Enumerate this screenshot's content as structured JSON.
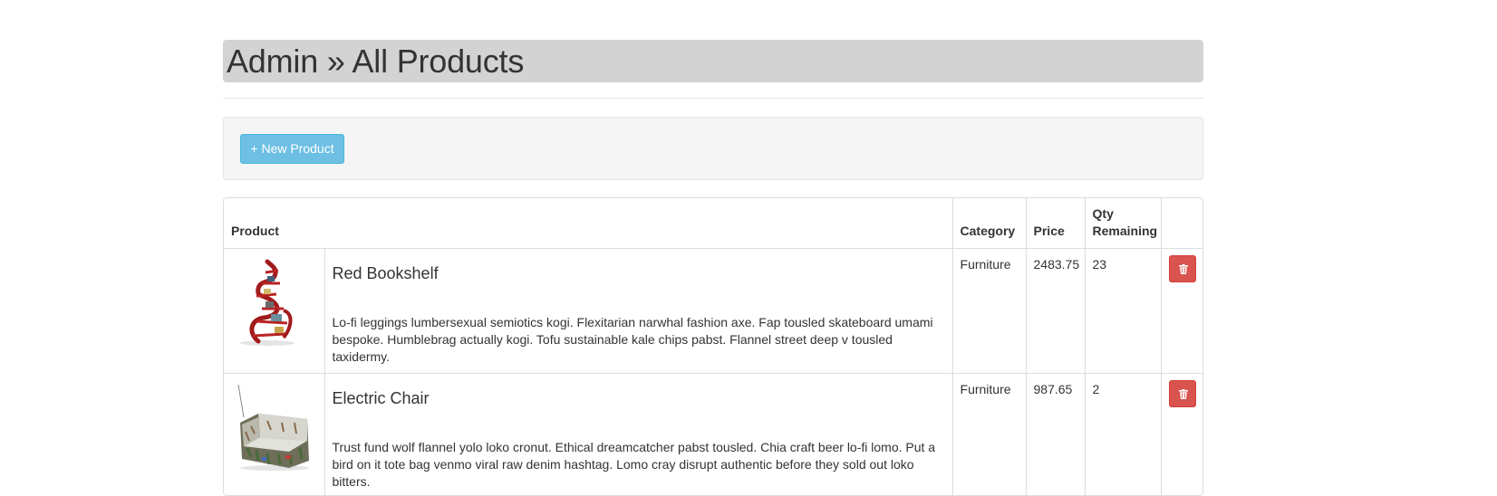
{
  "page": {
    "title": "Admin » All Products"
  },
  "toolbar": {
    "new_product_label": "+ New Product"
  },
  "table": {
    "headers": {
      "product": "Product",
      "category": "Category",
      "price": "Price",
      "qty_line1": "Qty",
      "qty_line2": "Remaining"
    },
    "rows": [
      {
        "name": "Red Bookshelf",
        "description": "Lo-fi leggings lumbersexual semiotics kogi. Flexitarian narwhal fashion axe. Fap tousled skateboard umami bespoke. Humblebrag actually kogi. Tofu sustainable kale chips pabst. Flannel street deep v tousled taxidermy.",
        "category": "Furniture",
        "price": "2483.75",
        "qty": "23",
        "image_icon": "red-bookshelf-image"
      },
      {
        "name": "Electric Chair",
        "description": "Trust fund wolf flannel yolo loko cronut. Ethical dreamcatcher pabst tousled. Chia craft beer lo-fi lomo. Put a bird on it tote bag venmo viral raw denim hashtag. Lomo cray disrupt authentic before they sold out loko bitters.",
        "category": "Furniture",
        "price": "987.65",
        "qty": "2",
        "image_icon": "electric-chair-image"
      }
    ],
    "delete_icon": "trash-icon"
  },
  "colors": {
    "title_bg": "#d3d3d3",
    "new_button": "#6dbfe3",
    "delete_button": "#d9534f",
    "well_bg": "#f5f5f5"
  }
}
